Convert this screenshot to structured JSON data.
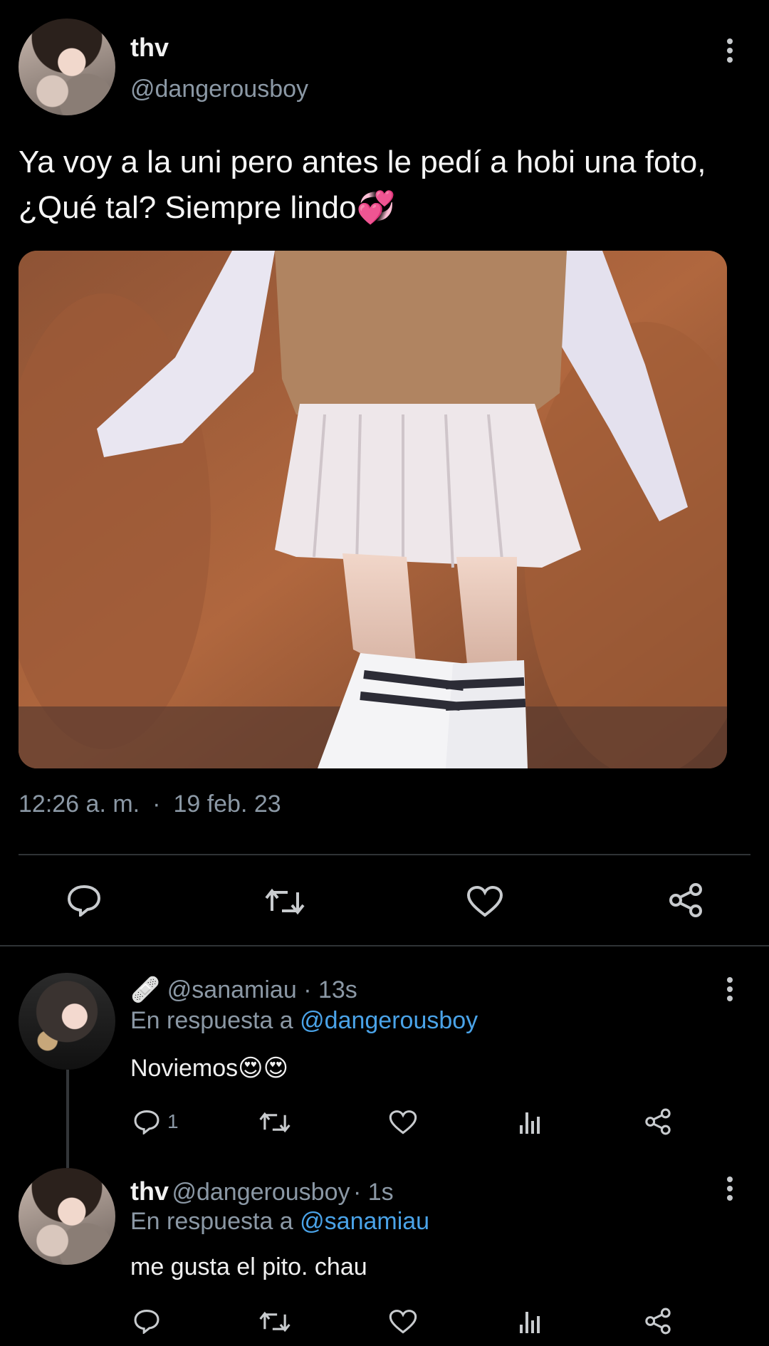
{
  "tweet": {
    "author_name": "thv",
    "author_handle": "@dangerousboy",
    "text_line1": "Ya voy a la uni pero antes le pedí a hobi una foto,",
    "text_line2": "¿Qué tal? Siempre lindo",
    "emoji": "💞",
    "time": "12:26 a. m.",
    "dot": "·",
    "date": "19 feb. 23"
  },
  "replies": [
    {
      "badge": "🩹",
      "handle": "@sanamiau",
      "time": "· 13s",
      "in_reply_prefix": "En respuesta a",
      "in_reply_handle": "@dangerousboy",
      "text": "Noviemos",
      "emoji": "😍😍",
      "reply_count": "1"
    },
    {
      "name": "thv",
      "handle": "@dangerousboy",
      "time": "· 1s",
      "in_reply_prefix": "En respuesta a",
      "in_reply_handle": "@sanamiau",
      "text": "me gusta el pito. chau"
    }
  ],
  "icons": {
    "reply": "reply-icon",
    "retweet": "retweet-icon",
    "like": "heart-icon",
    "share": "share-icon",
    "stats": "stats-icon",
    "more": "more-icon"
  },
  "colors": {
    "background": "#000000",
    "text": "#e7e9ea",
    "muted": "#8b98a5",
    "link": "#4aa3e8",
    "divider": "#2f3336"
  }
}
